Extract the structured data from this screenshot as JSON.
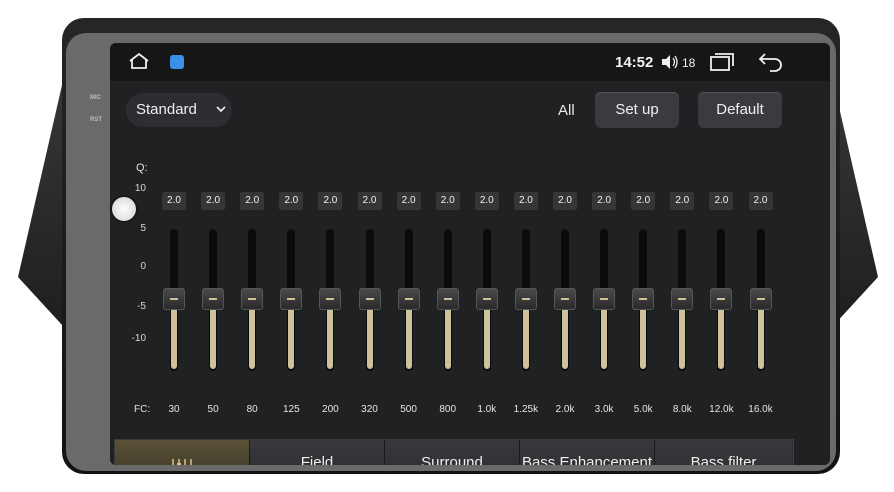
{
  "status_bar": {
    "time": "14:52",
    "volume": "18"
  },
  "side_labels": [
    "MIC",
    "RST"
  ],
  "header": {
    "preset": "Standard",
    "all_label": "All",
    "setup_button": "Set up",
    "default_button": "Default"
  },
  "eq": {
    "q_label": "Q:",
    "fc_label": "FC:",
    "y_axis": [
      "10",
      "5",
      "0",
      "-5",
      "-10"
    ],
    "bands": [
      {
        "fc": "30",
        "q": "2.0",
        "gain": 0
      },
      {
        "fc": "50",
        "q": "2.0",
        "gain": 0
      },
      {
        "fc": "80",
        "q": "2.0",
        "gain": 0
      },
      {
        "fc": "125",
        "q": "2.0",
        "gain": 0
      },
      {
        "fc": "200",
        "q": "2.0",
        "gain": 0
      },
      {
        "fc": "320",
        "q": "2.0",
        "gain": 0
      },
      {
        "fc": "500",
        "q": "2.0",
        "gain": 0
      },
      {
        "fc": "800",
        "q": "2.0",
        "gain": 0
      },
      {
        "fc": "1.0k",
        "q": "2.0",
        "gain": 0
      },
      {
        "fc": "1.25k",
        "q": "2.0",
        "gain": 0
      },
      {
        "fc": "2.0k",
        "q": "2.0",
        "gain": 0
      },
      {
        "fc": "3.0k",
        "q": "2.0",
        "gain": 0
      },
      {
        "fc": "5.0k",
        "q": "2.0",
        "gain": 0
      },
      {
        "fc": "8.0k",
        "q": "2.0",
        "gain": 0
      },
      {
        "fc": "12.0k",
        "q": "2.0",
        "gain": 0
      },
      {
        "fc": "16.0k",
        "q": "2.0",
        "gain": 0
      }
    ]
  },
  "tabs": [
    {
      "label": "",
      "icon": "equalizer-icon",
      "active": true
    },
    {
      "label": "Field",
      "active": false
    },
    {
      "label": "Surround",
      "active": false
    },
    {
      "label": "Bass Enhancement",
      "active": false
    },
    {
      "label": "Bass filter",
      "active": false
    }
  ]
}
